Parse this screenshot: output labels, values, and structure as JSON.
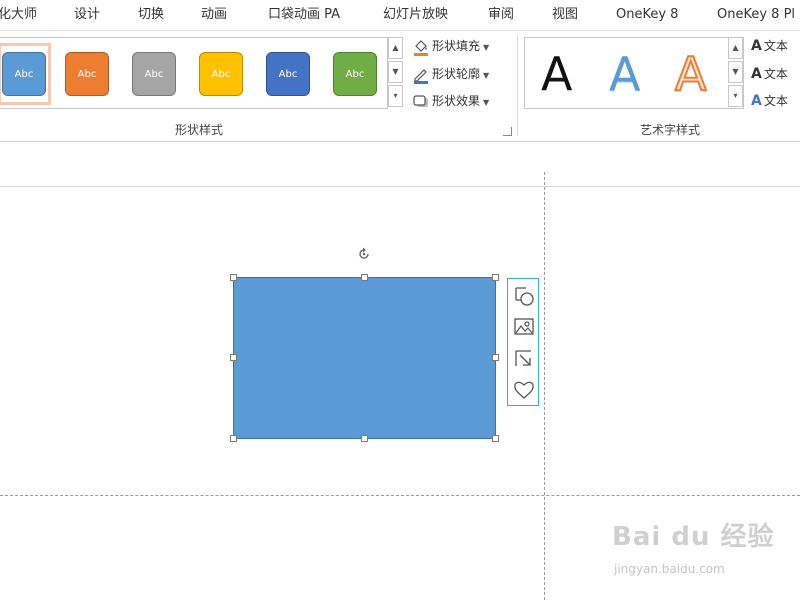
{
  "tabs": [
    {
      "label": "化大师"
    },
    {
      "label": "设计"
    },
    {
      "label": "切换"
    },
    {
      "label": "动画"
    },
    {
      "label": "口袋动画 PA"
    },
    {
      "label": "幻灯片放映"
    },
    {
      "label": "审阅"
    },
    {
      "label": "视图"
    },
    {
      "label": "OneKey 8"
    },
    {
      "label": "OneKey 8 Pl"
    }
  ],
  "shape_styles": {
    "group_label": "形状样式",
    "swatches": [
      {
        "text": "Abc",
        "color": "#5b9bd5",
        "selected": true
      },
      {
        "text": "Abc",
        "color": "#ed7d31"
      },
      {
        "text": "Abc",
        "color": "#a5a5a5"
      },
      {
        "text": "Abc",
        "color": "#ffc000"
      },
      {
        "text": "Abc",
        "color": "#4472c4"
      },
      {
        "text": "Abc",
        "color": "#70ad47"
      }
    ],
    "commands": [
      {
        "label": "形状填充",
        "icon": "paint-bucket-icon"
      },
      {
        "label": "形状轮廓",
        "icon": "pen-outline-icon"
      },
      {
        "label": "形状效果",
        "icon": "shape-effects-icon"
      }
    ]
  },
  "wordart_styles": {
    "group_label": "艺术字样式",
    "letters": [
      {
        "text": "A",
        "style": "black"
      },
      {
        "text": "A",
        "style": "blue-gradient"
      },
      {
        "text": "A",
        "style": "orange-outline"
      }
    ],
    "commands": [
      {
        "label": "文本"
      },
      {
        "label": "文本"
      },
      {
        "label": "文本"
      }
    ]
  },
  "quick_toolbar": {
    "buttons": [
      {
        "icon": "layout-options-icon"
      },
      {
        "icon": "picture-icon"
      },
      {
        "icon": "resize-icon"
      },
      {
        "icon": "heart-icon"
      }
    ]
  },
  "watermark": {
    "logo": "Bai du 经验",
    "url": "jingyan.baidu.com"
  },
  "colors": {
    "shape_fill": "#5b9bd5",
    "selection_ring": "#f6c9b3",
    "quick_toolbar_border": "#3aa7d3"
  }
}
